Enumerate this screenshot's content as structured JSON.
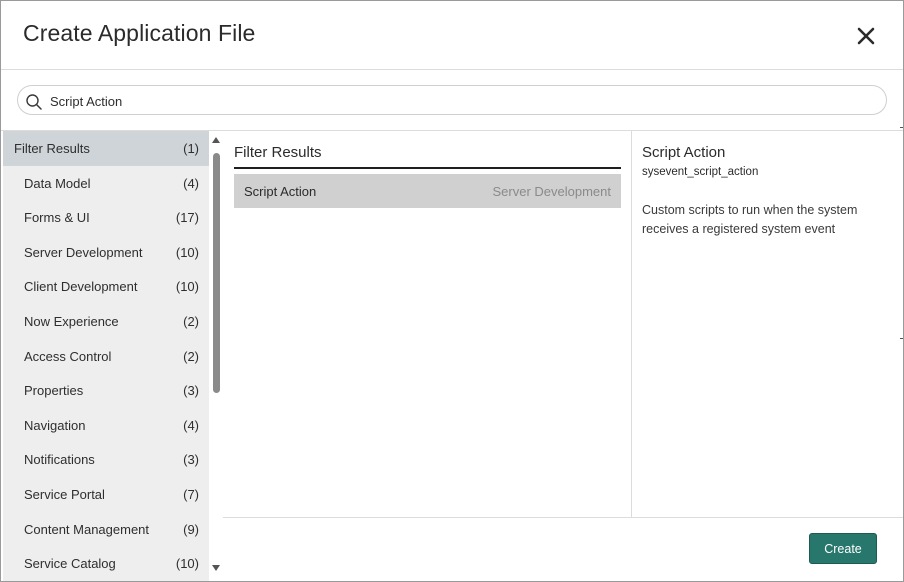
{
  "dialog": {
    "title": "Create Application File",
    "close_icon": "close-icon"
  },
  "search": {
    "icon": "search-icon",
    "value": "Script Action",
    "placeholder": ""
  },
  "sidebar": {
    "items": [
      {
        "label": "Filter Results",
        "count": "(1)",
        "active": true
      },
      {
        "label": "Data Model",
        "count": "(4)"
      },
      {
        "label": "Forms & UI",
        "count": "(17)"
      },
      {
        "label": "Server Development",
        "count": "(10)"
      },
      {
        "label": "Client Development",
        "count": "(10)"
      },
      {
        "label": "Now Experience",
        "count": "(2)"
      },
      {
        "label": "Access Control",
        "count": "(2)"
      },
      {
        "label": "Properties",
        "count": "(3)"
      },
      {
        "label": "Navigation",
        "count": "(4)"
      },
      {
        "label": "Notifications",
        "count": "(3)"
      },
      {
        "label": "Service Portal",
        "count": "(7)"
      },
      {
        "label": "Content Management",
        "count": "(9)"
      },
      {
        "label": "Service Catalog",
        "count": "(10)"
      }
    ]
  },
  "results": {
    "title": "Filter Results",
    "rows": [
      {
        "name": "Script Action",
        "category": "Server Development"
      }
    ]
  },
  "detail": {
    "title": "Script Action",
    "table": "sysevent_script_action",
    "description": "Custom scripts to run when the system receives a registered system event"
  },
  "footer": {
    "create_label": "Create"
  },
  "colors": {
    "primary": "#28776c",
    "sidebar_bg": "#eeeeee",
    "active_item": "#cfd4d8",
    "selected_row": "#d0d0d0"
  }
}
